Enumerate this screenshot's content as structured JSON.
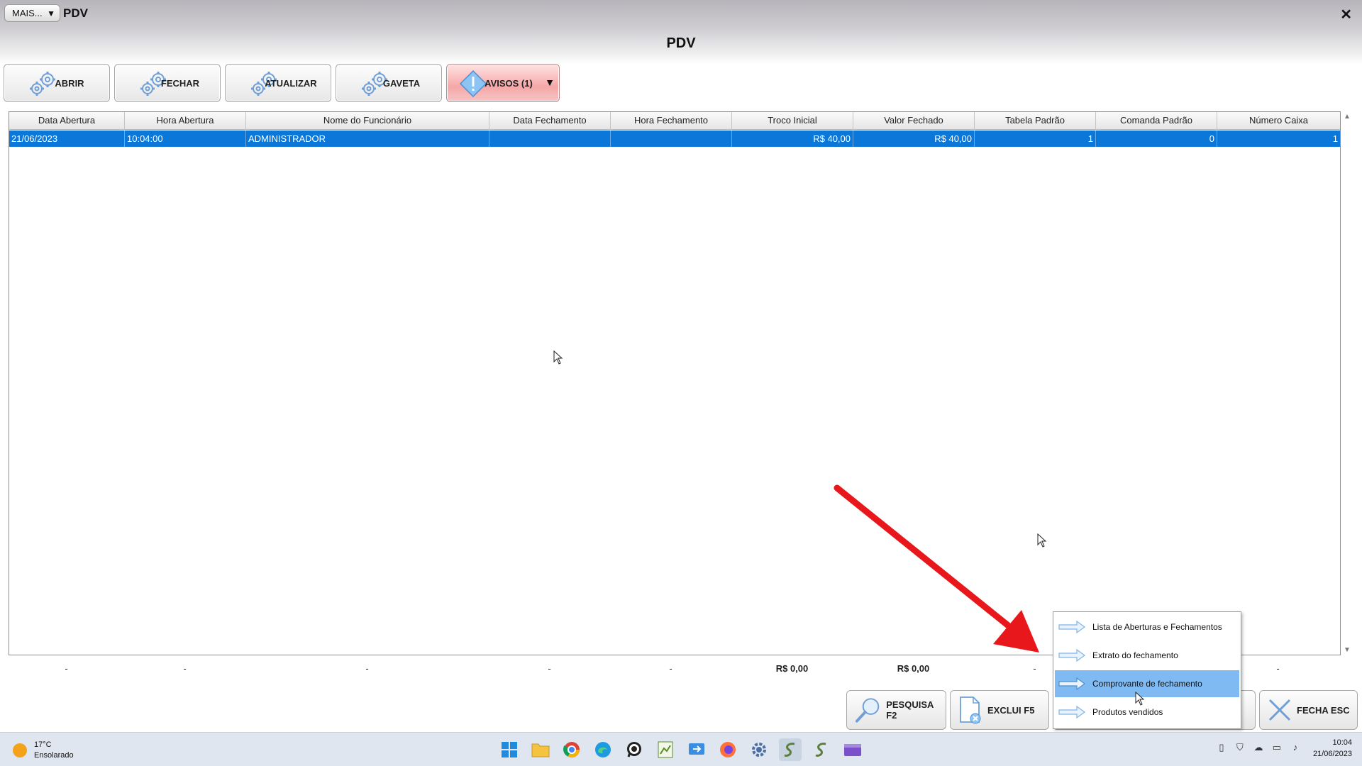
{
  "window": {
    "mais_label": "MAIS...",
    "title": "PDV",
    "close_symbol": "✕"
  },
  "page_title": "PDV",
  "toolbar": {
    "abrir": "ABRIR",
    "fechar": "FECHAR",
    "atualizar": "ATUALIZAR",
    "gaveta": "GAVETA",
    "avisos": "AVISOS (1)"
  },
  "grid": {
    "columns": [
      "Data Abertura",
      "Hora Abertura",
      "Nome do Funcionário",
      "Data Fechamento",
      "Hora Fechamento",
      "Troco Inicial",
      "Valor Fechado",
      "Tabela Padrão",
      "Comanda Padrão",
      "Número Caixa"
    ],
    "rows": [
      [
        "21/06/2023",
        "10:04:00",
        "ADMINISTRADOR",
        "",
        "",
        "R$ 40,00",
        "R$ 40,00",
        "1",
        "0",
        "1"
      ]
    ]
  },
  "totals": [
    "-",
    "-",
    "-",
    "-",
    "-",
    "R$ 0,00",
    "R$ 0,00",
    "-",
    "-",
    "-"
  ],
  "bottom_buttons": {
    "pesquisa": "PESQUISA F2",
    "exclui": "EXCLUI F5",
    "fecha": "FECHA ESC"
  },
  "context_menu": {
    "items": [
      "Lista de Aberturas e Fechamentos",
      "Extrato do fechamento",
      "Comprovante de fechamento",
      "Produtos vendidos"
    ],
    "highlighted_index": 2
  },
  "taskbar": {
    "temperature": "17°C",
    "weather": "Ensolarado",
    "time": "10:04",
    "date": "21/06/2023"
  },
  "colors": {
    "selection": "#0b78d9",
    "menu_highlight": "#7fbaf2",
    "arrow": "#e8171c",
    "warn_button": "#f5a7a7"
  }
}
